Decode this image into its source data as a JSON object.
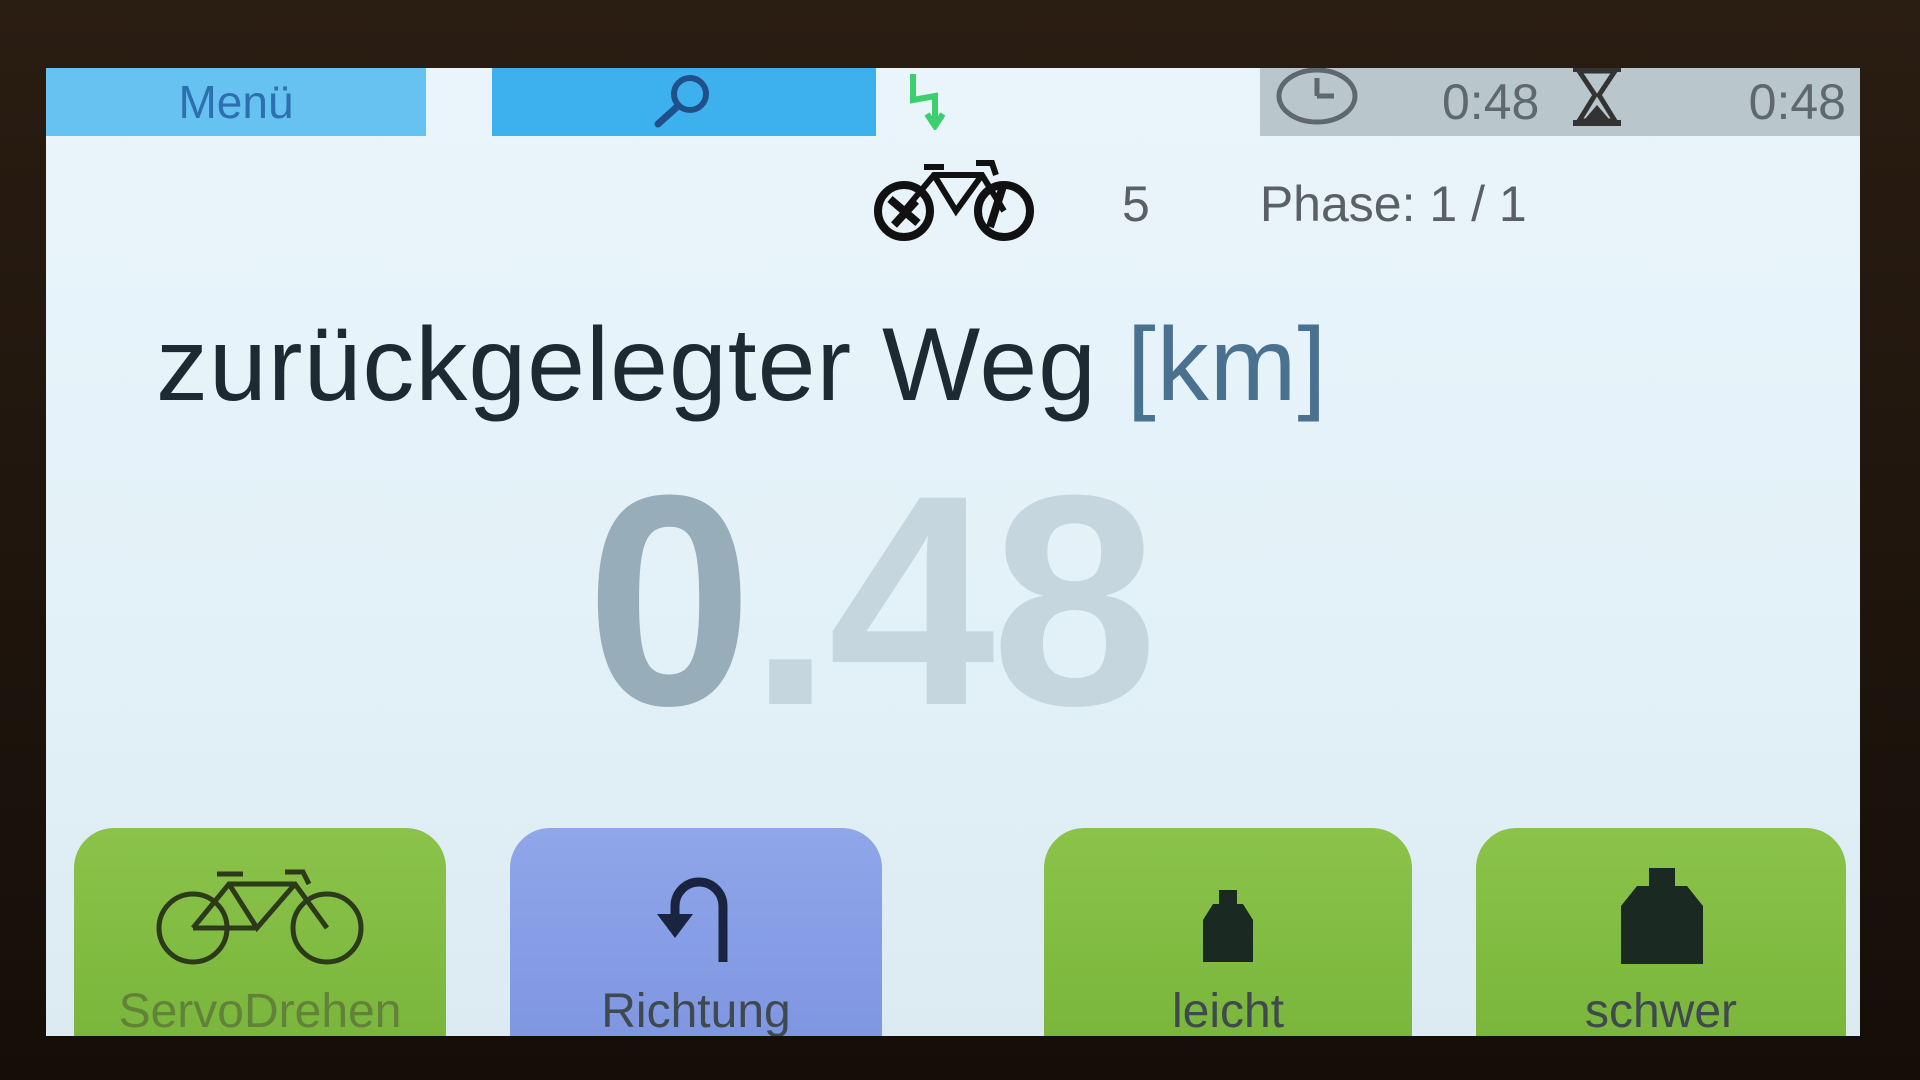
{
  "topbar": {
    "menu_label": "Menü",
    "search_icon": "search-icon",
    "power_icon": "lightning-icon",
    "clock_icon": "clock-icon",
    "elapsed_time": "0:48",
    "hourglass_icon": "hourglass-icon",
    "remaining_time": "0:48"
  },
  "stats": {
    "bike_icon": "bike-icon",
    "count": "5",
    "phase": "Phase: 1 / 1"
  },
  "measurement": {
    "title": "zurückgelegter Weg",
    "unit": "[km]",
    "value_first": "0",
    "value_rest": ".48"
  },
  "buttons": [
    {
      "label": "ServoDrehen",
      "icon": "bicycle-icon"
    },
    {
      "label": "Richtung",
      "icon": "turn-arrow-icon"
    },
    {
      "label": "leicht",
      "icon": "small-weight-icon"
    },
    {
      "label": "schwer",
      "icon": "large-weight-icon"
    }
  ],
  "colors": {
    "menu_blue": "#66c2f0",
    "search_blue": "#3db0ee",
    "accent_green": "#3ccf70",
    "button_green": "#8bc34a",
    "button_blue": "#8fa6ea"
  }
}
